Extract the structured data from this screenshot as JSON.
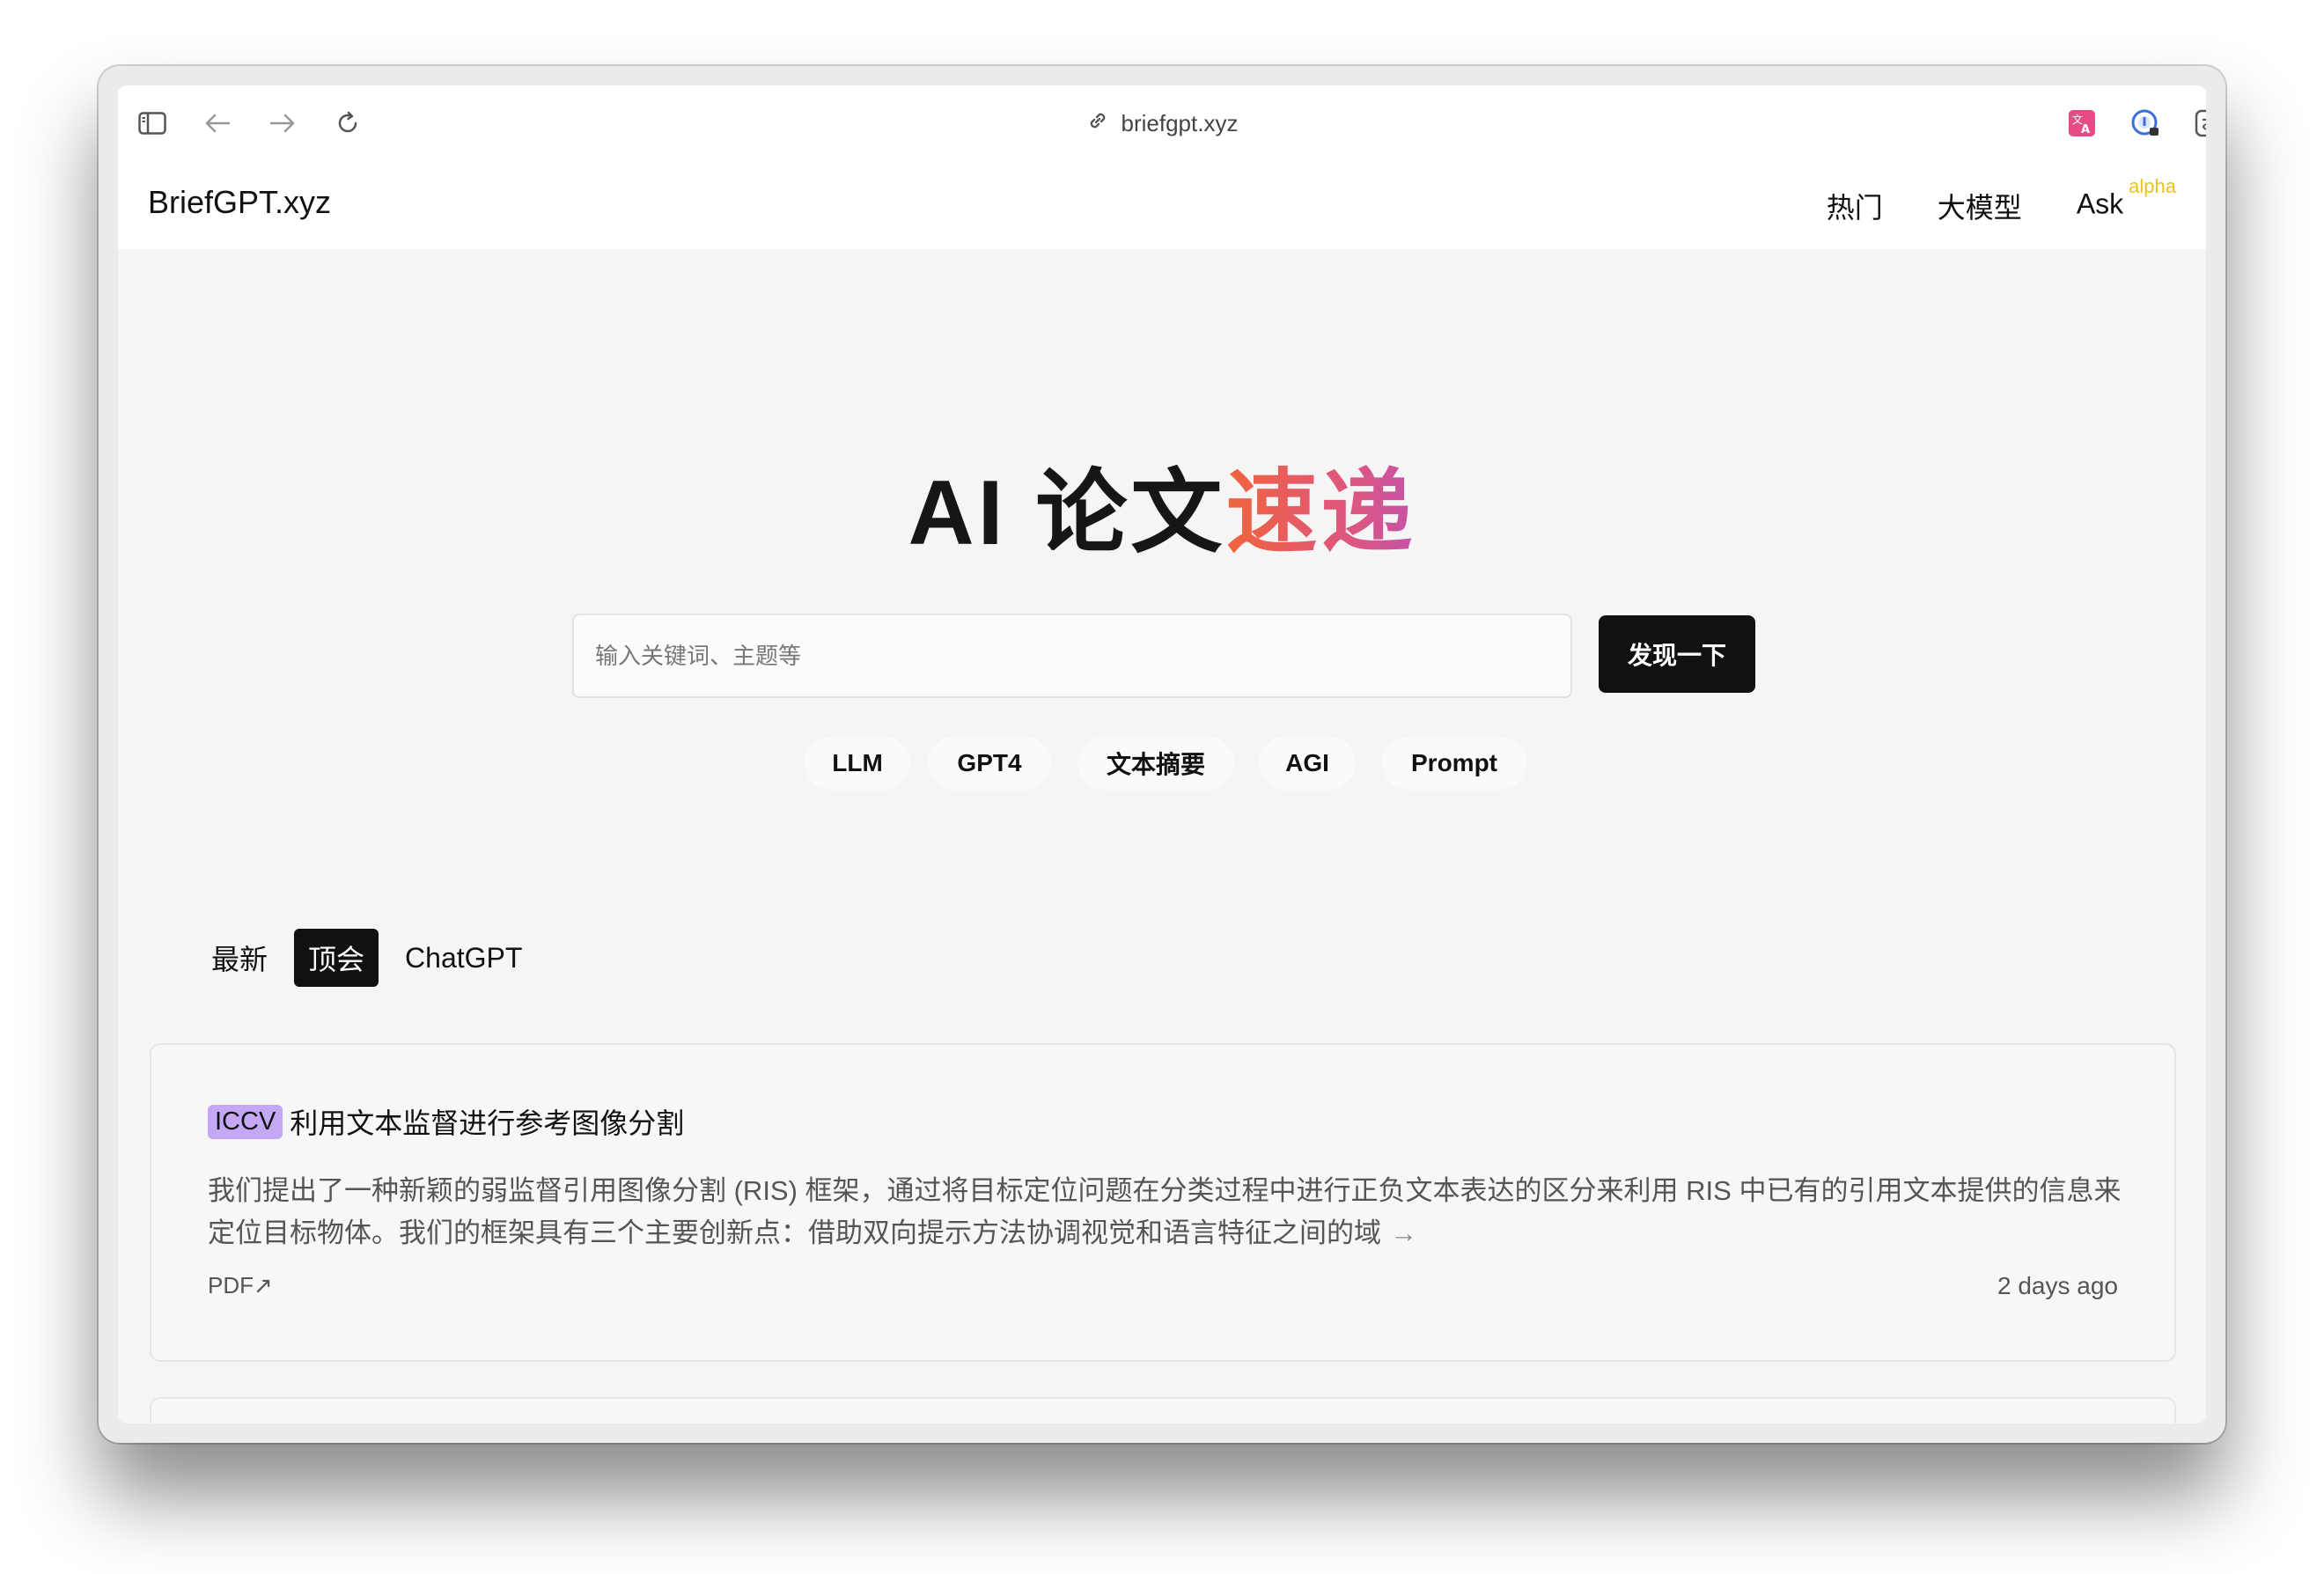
{
  "browser": {
    "url": "briefgpt.xyz"
  },
  "site": {
    "brand": "BriefGPT.xyz",
    "nav": [
      {
        "label": "热门"
      },
      {
        "label": "大模型"
      },
      {
        "label": "Ask",
        "tag": "alpha"
      }
    ]
  },
  "hero": {
    "title_plain": "AI 论文",
    "title_accent": "速递"
  },
  "search": {
    "placeholder": "输入关键词、主题等",
    "value": "",
    "button_label": "发现一下"
  },
  "chips": [
    "LLM",
    "GPT4",
    "文本摘要",
    "AGI",
    "Prompt"
  ],
  "tabs": [
    {
      "label": "最新",
      "active": false
    },
    {
      "label": "顶会",
      "active": true
    },
    {
      "label": "ChatGPT",
      "active": false
    }
  ],
  "papers": [
    {
      "venue": "ICCV",
      "title": "利用文本监督进行参考图像分割",
      "abstract": "我们提出了一种新颖的弱监督引用图像分割 (RIS) 框架，通过将目标定位问题在分类过程中进行正负文本表达的区分来利用 RIS 中已有的引用文本提供的信息来定位目标物体。我们的框架具有三个主要创新点：借助双向提示方法协调视觉和语言特征之间的域",
      "more": "→",
      "pdf_label": "PDF↗",
      "time": "2 days ago"
    }
  ],
  "colors": {
    "accent_gradient": [
      "#f0643b",
      "#e0577a",
      "#c653a7"
    ],
    "badge": "#c4a8f5",
    "alpha_tag": "#e8c321"
  }
}
